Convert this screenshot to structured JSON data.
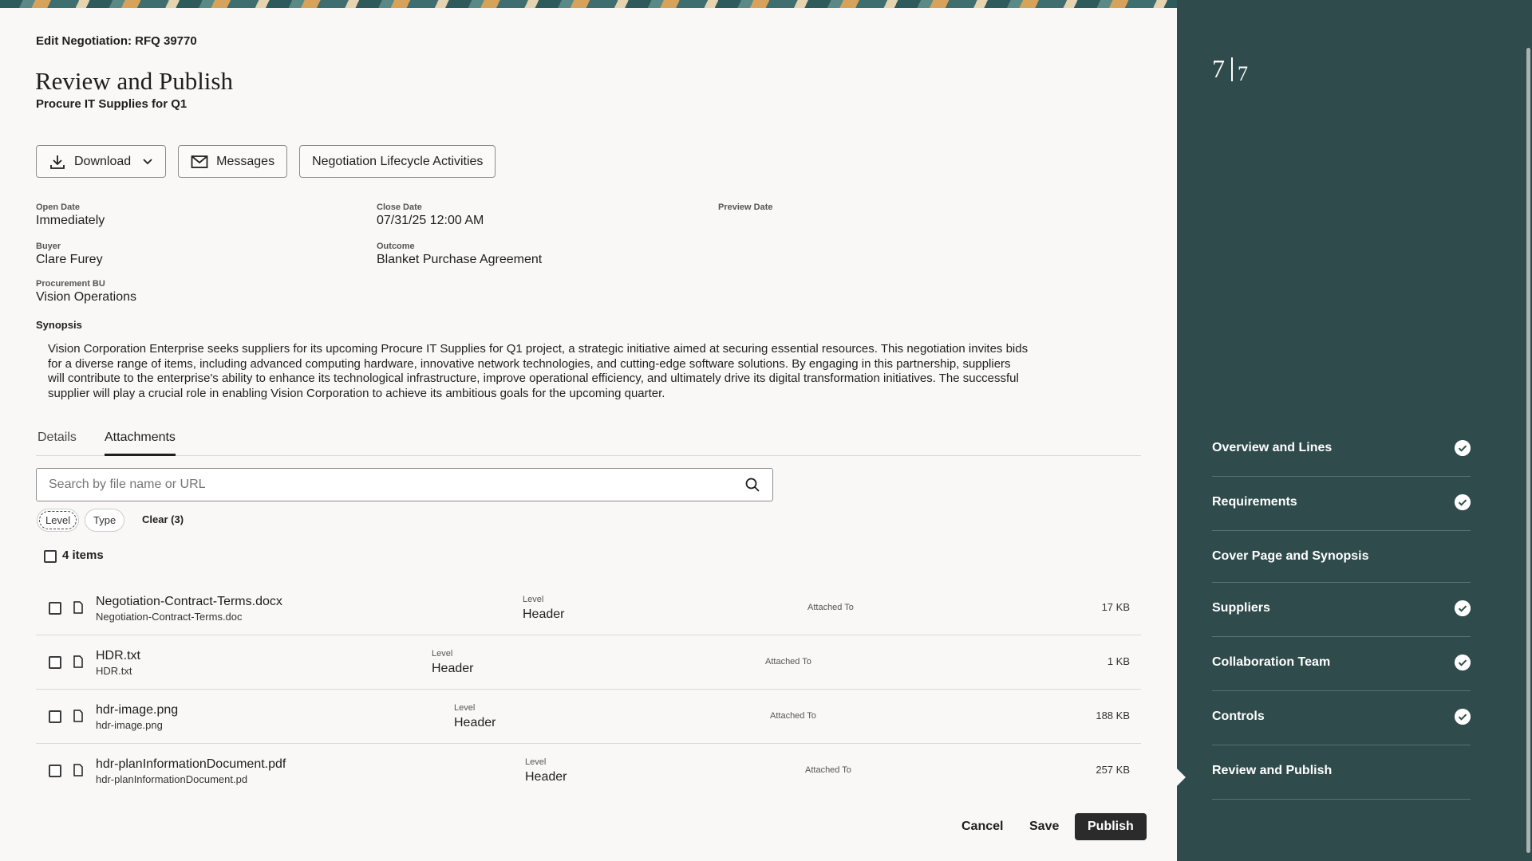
{
  "header": {
    "edit_title": "Edit Negotiation: RFQ 39770",
    "title": "Review and Publish",
    "subtitle": "Procure IT Supplies for Q1"
  },
  "toolbar": {
    "download_label": "Download",
    "messages_label": "Messages",
    "lifecycle_label": "Negotiation Lifecycle Activities"
  },
  "fields": {
    "open_date": {
      "label": "Open Date",
      "value": "Immediately"
    },
    "close_date": {
      "label": "Close Date",
      "value": "07/31/25 12:00 AM"
    },
    "preview_date": {
      "label": "Preview Date",
      "value": ""
    },
    "buyer": {
      "label": "Buyer",
      "value": "Clare Furey"
    },
    "outcome": {
      "label": "Outcome",
      "value": "Blanket Purchase Agreement"
    },
    "procurement_bu": {
      "label": "Procurement BU",
      "value": "Vision Operations"
    }
  },
  "synopsis": {
    "label": "Synopsis",
    "text": "Vision Corporation Enterprise seeks suppliers for its upcoming Procure IT Supplies for Q1 project, a strategic initiative aimed at securing essential resources. This negotiation invites bids for a diverse range of items, including advanced computing hardware, innovative network technologies, and cutting-edge software solutions. By engaging in this partnership, suppliers will contribute to the enterprise's ability to enhance its technological infrastructure, improve operational efficiency, and ultimately drive its digital transformation initiatives. The successful supplier will play a crucial role in enabling Vision Corporation to achieve its ambitious goals for the upcoming quarter."
  },
  "tabs": [
    {
      "label": "Details",
      "active": false
    },
    {
      "label": "Attachments",
      "active": true
    }
  ],
  "attachments": {
    "search_placeholder": "Search by file name or URL",
    "filters": {
      "level": "Level",
      "type": "Type",
      "clear": "Clear (3)"
    },
    "items_count": "4 items",
    "level_label": "Level",
    "attached_label": "Attached To",
    "rows": [
      {
        "name": "Negotiation-Contract-Terms.docx",
        "sub": "Negotiation-Contract-Terms.doc",
        "level": "Header",
        "size": "17 KB"
      },
      {
        "name": "HDR.txt",
        "sub": "HDR.txt",
        "level": "Header",
        "size": "1 KB"
      },
      {
        "name": "hdr-image.png",
        "sub": "hdr-image.png",
        "level": "Header",
        "size": "188 KB"
      },
      {
        "name": "hdr-planInformationDocument.pdf",
        "sub": "hdr-planInformationDocument.pd",
        "level": "Header",
        "size": "257 KB"
      }
    ]
  },
  "footer": {
    "cancel": "Cancel",
    "save": "Save",
    "publish": "Publish"
  },
  "side_panel": {
    "step_current": "7",
    "step_total": "7",
    "steps": [
      {
        "label": "Overview and Lines",
        "complete": true
      },
      {
        "label": "Requirements",
        "complete": true
      },
      {
        "label": "Cover Page and Synopsis",
        "complete": false
      },
      {
        "label": "Suppliers",
        "complete": true
      },
      {
        "label": "Collaboration Team",
        "complete": true
      },
      {
        "label": "Controls",
        "complete": true
      },
      {
        "label": "Review and Publish",
        "complete": false,
        "current": true
      }
    ]
  },
  "colors": {
    "panel_bg": "#2f4b4c",
    "primary_button": "#2b2b2b"
  }
}
